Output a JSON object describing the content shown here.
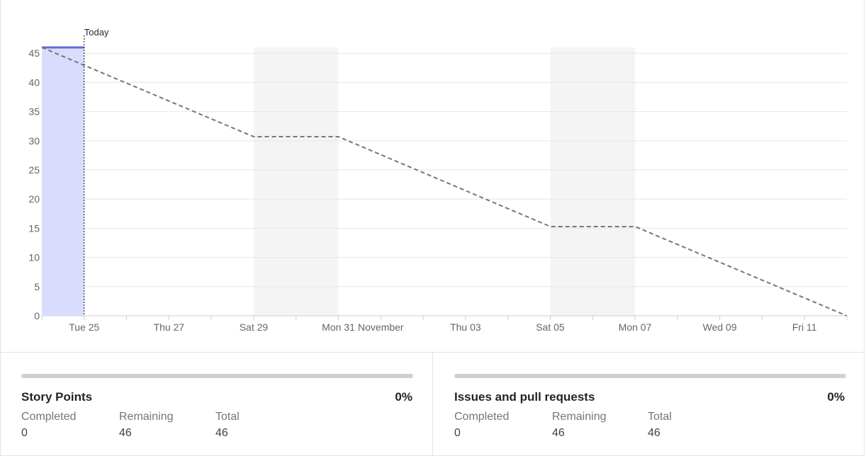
{
  "chart_data": {
    "type": "line",
    "today_label": "Today",
    "yticks": [
      0,
      5,
      10,
      15,
      20,
      25,
      30,
      35,
      40,
      45
    ],
    "ylim": [
      0,
      46
    ],
    "xlim": [
      "2022-10-24",
      "2022-11-12"
    ],
    "xticks": [
      {
        "date": "2022-10-25",
        "label": "Tue 25"
      },
      {
        "date": "2022-10-27",
        "label": "Thu 27"
      },
      {
        "date": "2022-10-29",
        "label": "Sat 29"
      },
      {
        "date": "2022-10-31",
        "label": "Mon 31"
      },
      {
        "date": "2022-11-01",
        "label": "November"
      },
      {
        "date": "2022-11-03",
        "label": "Thu 03"
      },
      {
        "date": "2022-11-05",
        "label": "Sat 05"
      },
      {
        "date": "2022-11-07",
        "label": "Mon 07"
      },
      {
        "date": "2022-11-09",
        "label": "Wed 09"
      },
      {
        "date": "2022-11-11",
        "label": "Fri 11"
      }
    ],
    "today": "2022-10-25",
    "weekend_bands": [
      {
        "start": "2022-10-29",
        "end": "2022-10-31"
      },
      {
        "start": "2022-11-05",
        "end": "2022-11-07"
      }
    ],
    "series": [
      {
        "style": "solid",
        "color": "#5b6fd6",
        "fill": "#d9dcfc",
        "points": [
          {
            "x": "2022-10-24",
            "y": 46
          },
          {
            "x": "2022-10-25",
            "y": 46
          }
        ]
      },
      {
        "style": "dashed",
        "color": "#777777",
        "points": [
          {
            "x": "2022-10-24",
            "y": 46
          },
          {
            "x": "2022-10-29",
            "y": 30.7
          },
          {
            "x": "2022-10-31",
            "y": 30.7
          },
          {
            "x": "2022-11-05",
            "y": 15.3
          },
          {
            "x": "2022-11-07",
            "y": 15.3
          },
          {
            "x": "2022-11-12",
            "y": 0
          }
        ]
      }
    ],
    "grid": true,
    "legend": "none"
  },
  "stats": [
    {
      "title": "Story Points",
      "percent": "0%",
      "progress": 0,
      "metrics": [
        {
          "label": "Completed",
          "value": "0"
        },
        {
          "label": "Remaining",
          "value": "46"
        },
        {
          "label": "Total",
          "value": "46"
        }
      ]
    },
    {
      "title": "Issues and pull requests",
      "percent": "0%",
      "progress": 0,
      "metrics": [
        {
          "label": "Completed",
          "value": "0"
        },
        {
          "label": "Remaining",
          "value": "46"
        },
        {
          "label": "Total",
          "value": "46"
        }
      ]
    }
  ],
  "colors": {
    "grid": "#e6e6e6",
    "weekend_band": "#f4f4f4",
    "axis_text": "#666666"
  }
}
